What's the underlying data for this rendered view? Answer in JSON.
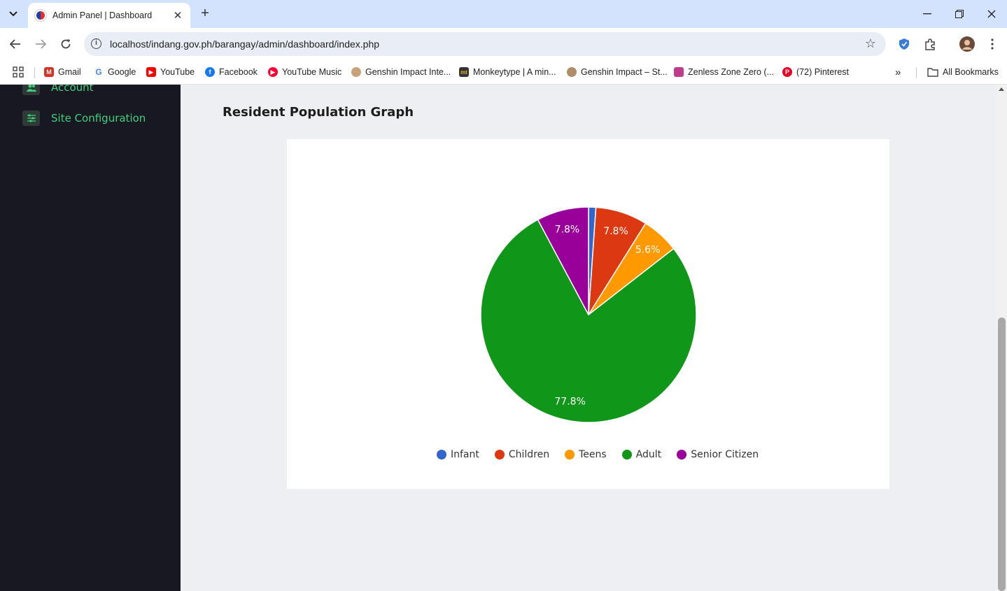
{
  "browser": {
    "tab_title": "Admin Panel | Dashboard",
    "url": "localhost/indang.gov.ph/barangay/admin/dashboard/index.php",
    "bookmarks": [
      {
        "label": "Gmail",
        "icon": "gmail-icon",
        "color": "#d93025"
      },
      {
        "label": "Google",
        "icon": "google-icon",
        "color": "#4285f4"
      },
      {
        "label": "YouTube",
        "icon": "youtube-icon",
        "color": "#ff0000"
      },
      {
        "label": "Facebook",
        "icon": "facebook-icon",
        "color": "#1877f2"
      },
      {
        "label": "YouTube Music",
        "icon": "youtube-music-icon",
        "color": "#ff0033"
      },
      {
        "label": "Genshin Impact Inte...",
        "icon": "genshin-icon",
        "color": "#c7a37a"
      },
      {
        "label": "Monkeytype | A min...",
        "icon": "monkeytype-icon",
        "color": "#323437"
      },
      {
        "label": "Genshin Impact – St...",
        "icon": "genshin-icon",
        "color": "#b08d6a"
      },
      {
        "label": "Zenless Zone Zero (...",
        "icon": "zzz-icon",
        "color": "#c13b8c"
      },
      {
        "label": "(72) Pinterest",
        "icon": "pinterest-icon",
        "color": "#e60023"
      }
    ],
    "all_bookmarks": "All Bookmarks"
  },
  "sidebar": {
    "items": [
      {
        "label": "Account",
        "icon": "users-icon"
      },
      {
        "label": "Site Configuration",
        "icon": "sliders-icon"
      }
    ]
  },
  "main": {
    "section_title": "Resident Population Graph"
  },
  "chart_data": {
    "type": "pie",
    "title": "",
    "categories": [
      "Infant",
      "Children",
      "Teens",
      "Adult",
      "Senior Citizen"
    ],
    "values": [
      1.1,
      7.8,
      5.6,
      77.8,
      7.8
    ],
    "slice_labels": [
      "",
      "7.8%",
      "5.6%",
      "77.8%",
      "7.8%"
    ],
    "colors": [
      "#3366cc",
      "#dc3912",
      "#ff9900",
      "#109618",
      "#990099"
    ],
    "legend_position": "bottom"
  }
}
